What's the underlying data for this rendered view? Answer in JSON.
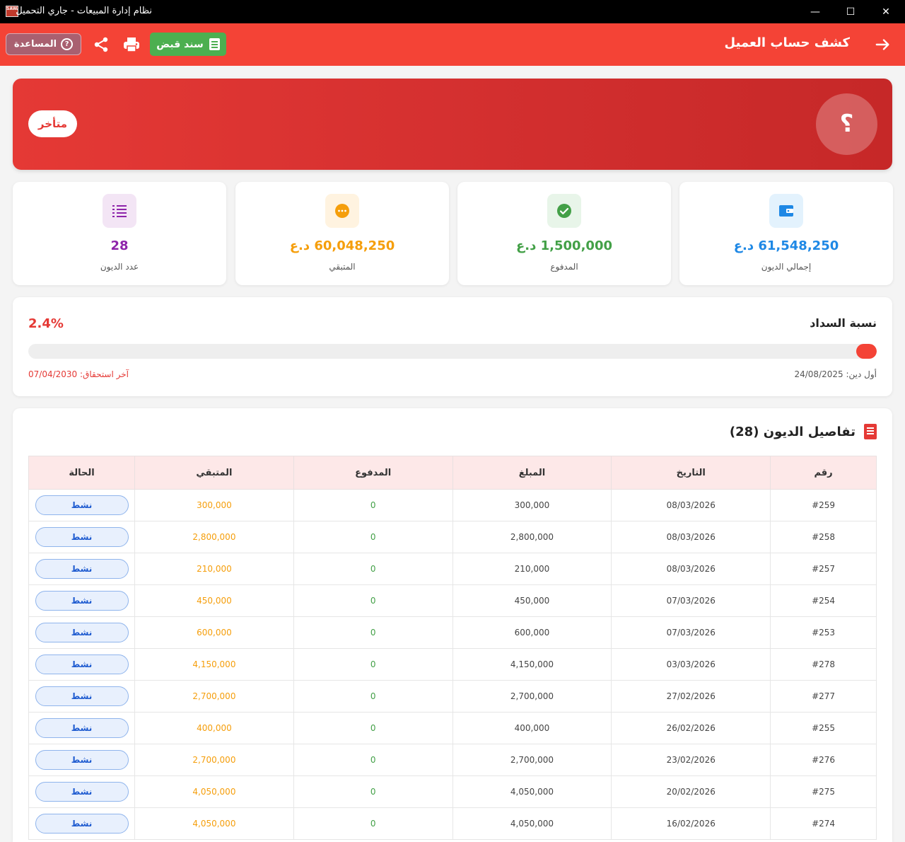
{
  "window": {
    "title": "نظام إدارة المبيعات - جاري التحميل",
    "icon_text": "SAWA",
    "minimize_glyph": "—",
    "maximize_glyph": "☐",
    "close_glyph": "✕"
  },
  "toolbar": {
    "title": "كشف حساب العميل",
    "back_icon": "arrow-right-icon",
    "receipt_label": "سند قبض",
    "help_label": "المساعدة",
    "accent": "#f44336"
  },
  "banner": {
    "avatar_char": "؟",
    "status": "متأخر",
    "color": "#e53935"
  },
  "stats": [
    {
      "value": "61,548,250 د.ع",
      "label": "إجمالي الديون",
      "color": "#1e88e5",
      "icon": "wallet-icon"
    },
    {
      "value": "1,500,000 د.ع",
      "label": "المدفوع",
      "color": "#43a047",
      "icon": "check-circle-icon"
    },
    {
      "value": "60,048,250 د.ع",
      "label": "المتبقي",
      "color": "#f59e0b",
      "icon": "more-circle-icon"
    },
    {
      "value": "28",
      "label": "عدد الديون",
      "color": "#8e24aa",
      "icon": "list-icon"
    }
  ],
  "progress": {
    "title": "نسبة السداد",
    "percent_text": "2.4%",
    "percent": 2.4,
    "first_debt": "أول دين: 24/08/2025",
    "last_due": "آخر استحقاق: 07/04/2030"
  },
  "debts": {
    "title": "تفاصيل الديون (28)",
    "columns": [
      "رقم",
      "التاريخ",
      "المبلغ",
      "المدفوع",
      "المتبقي",
      "الحالة"
    ],
    "rows": [
      {
        "id": "#259",
        "date": "08/03/2026",
        "amount": "300,000",
        "paid": "0",
        "remaining": "300,000",
        "status": "نشط"
      },
      {
        "id": "#258",
        "date": "08/03/2026",
        "amount": "2,800,000",
        "paid": "0",
        "remaining": "2,800,000",
        "status": "نشط"
      },
      {
        "id": "#257",
        "date": "08/03/2026",
        "amount": "210,000",
        "paid": "0",
        "remaining": "210,000",
        "status": "نشط"
      },
      {
        "id": "#254",
        "date": "07/03/2026",
        "amount": "450,000",
        "paid": "0",
        "remaining": "450,000",
        "status": "نشط"
      },
      {
        "id": "#253",
        "date": "07/03/2026",
        "amount": "600,000",
        "paid": "0",
        "remaining": "600,000",
        "status": "نشط"
      },
      {
        "id": "#278",
        "date": "03/03/2026",
        "amount": "4,150,000",
        "paid": "0",
        "remaining": "4,150,000",
        "status": "نشط"
      },
      {
        "id": "#277",
        "date": "27/02/2026",
        "amount": "2,700,000",
        "paid": "0",
        "remaining": "2,700,000",
        "status": "نشط"
      },
      {
        "id": "#255",
        "date": "26/02/2026",
        "amount": "400,000",
        "paid": "0",
        "remaining": "400,000",
        "status": "نشط"
      },
      {
        "id": "#276",
        "date": "23/02/2026",
        "amount": "2,700,000",
        "paid": "0",
        "remaining": "2,700,000",
        "status": "نشط"
      },
      {
        "id": "#275",
        "date": "20/02/2026",
        "amount": "4,050,000",
        "paid": "0",
        "remaining": "4,050,000",
        "status": "نشط"
      },
      {
        "id": "#274",
        "date": "16/02/2026",
        "amount": "4,050,000",
        "paid": "0",
        "remaining": "4,050,000",
        "status": "نشط"
      }
    ]
  }
}
